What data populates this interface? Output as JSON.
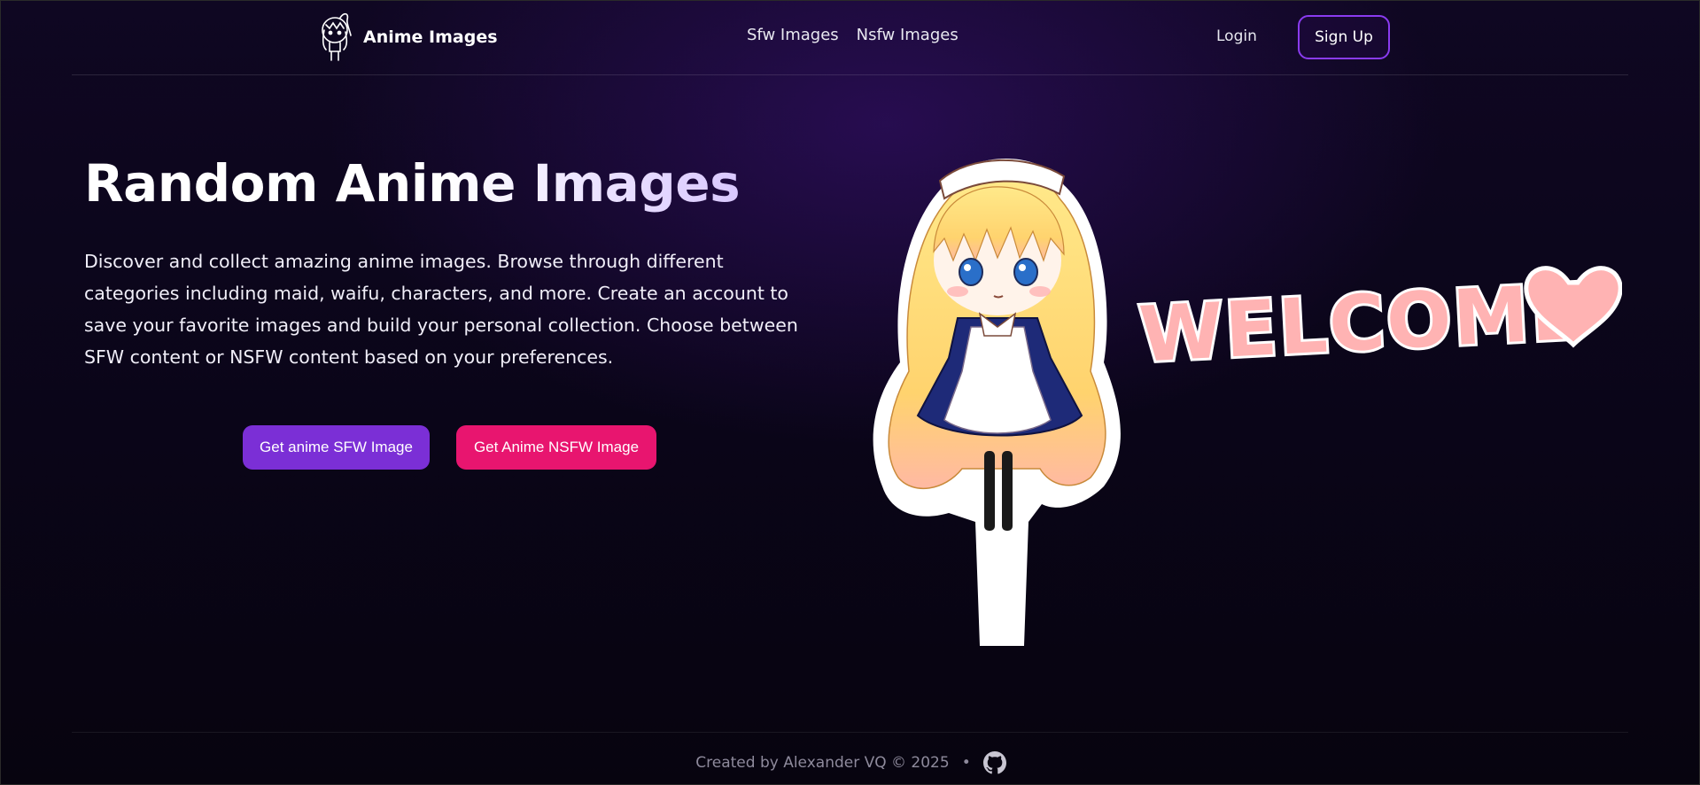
{
  "header": {
    "brand_name": "Anime Images",
    "nav": [
      {
        "label": "Sfw Images"
      },
      {
        "label": "Nsfw Images"
      }
    ],
    "login_label": "Login",
    "signup_label": "Sign Up"
  },
  "hero": {
    "title": "Random Anime Images",
    "description": "Discover and collect amazing anime images. Browse through different categories including maid, waifu, characters, and more. Create an account to save your favorite images and build your personal collection. Choose between SFW content or NSFW content based on your preferences.",
    "sfw_button": "Get anime SFW Image",
    "nsfw_button": "Get Anime NSFW Image",
    "illustration_text": "WELCOME"
  },
  "footer": {
    "credit": "Created by Alexander VQ © 2025",
    "separator": "•"
  },
  "colors": {
    "accent_purple": "#7b2fd6",
    "accent_pink": "#e8156f",
    "signup_border": "#8a3bf0"
  }
}
